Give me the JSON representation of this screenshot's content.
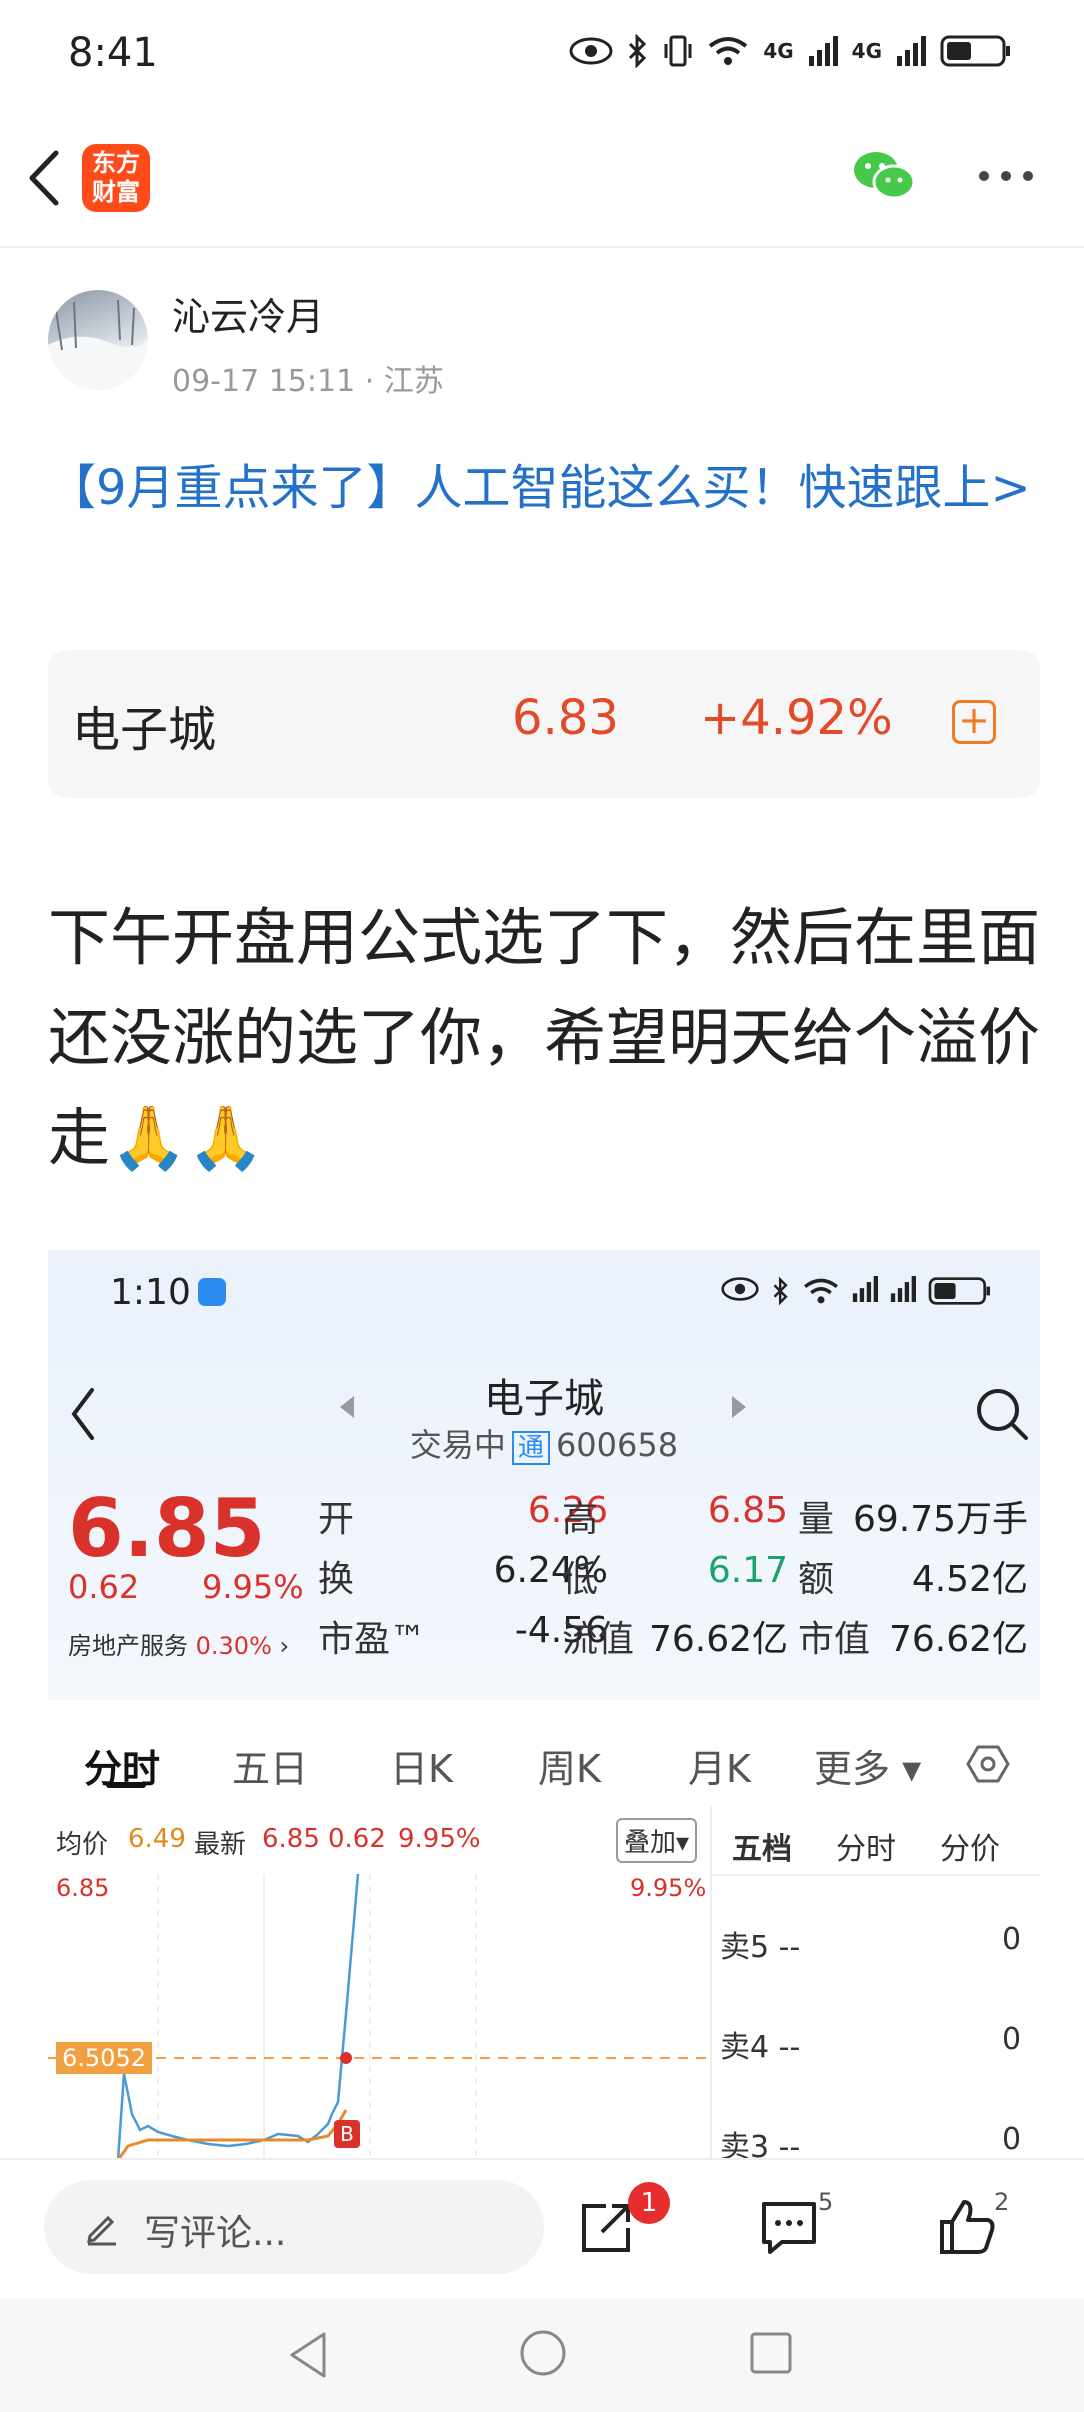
{
  "status": {
    "time": "8:41",
    "net1": "4G",
    "net2": "4G"
  },
  "header": {
    "logo_line1": "东方",
    "logo_line2": "财富"
  },
  "post": {
    "author": "沁云冷月",
    "meta": "09-17 15:11 · 江苏",
    "title_link": "【9月重点来了】人工智能这么买！快速跟上>",
    "stock": {
      "name": "电子城",
      "price": "6.83",
      "change": "+4.92%"
    },
    "body": "下午开盘用公式选了下，然后在里面还没涨的选了你，希望明天给个溢价走🙏🙏"
  },
  "shot": {
    "time": "1:10",
    "name": "电子城",
    "status": "交易中",
    "tong": "通",
    "code": "600658",
    "price": "6.85",
    "chg": "0.62",
    "pct": "9.95%",
    "sector": "房地产服务",
    "sector_pct": "0.30%",
    "quote": [
      {
        "k1": "开",
        "v1": "6.26",
        "k2": "高",
        "v2": "6.85",
        "k3": "量",
        "v3": "69.75万手"
      },
      {
        "k1": "换",
        "v1": "6.24%",
        "k2": "低",
        "v2": "6.17",
        "k3": "额",
        "v3": "4.52亿"
      },
      {
        "k1": "市盈™",
        "v1": "-4.56",
        "k2": "流值",
        "v2": "76.62亿",
        "k3": "市值",
        "v3": "76.62亿"
      }
    ],
    "tabs": [
      "分时",
      "五日",
      "日K",
      "周K",
      "月K",
      "更多"
    ],
    "chartbar": {
      "avg_label": "均价",
      "avg": "6.49",
      "last_label": "最新",
      "last": "6.85",
      "chg": "0.62",
      "pct": "9.95%",
      "overlay": "叠加"
    },
    "chart": {
      "ymax": "6.85",
      "ymax_pct": "9.95%",
      "marker": "6.5052",
      "buy": "B"
    },
    "orderbook": {
      "tabs": [
        "五档",
        "分时",
        "分价"
      ],
      "rows": [
        {
          "label": "卖5",
          "price": "--",
          "vol": "0"
        },
        {
          "label": "卖4",
          "price": "--",
          "vol": "0"
        },
        {
          "label": "卖3",
          "price": "--",
          "vol": "0"
        }
      ]
    }
  },
  "bottom": {
    "placeholder": "写评论...",
    "share_badge": "1",
    "comment_count": "5",
    "like_count": "2"
  }
}
